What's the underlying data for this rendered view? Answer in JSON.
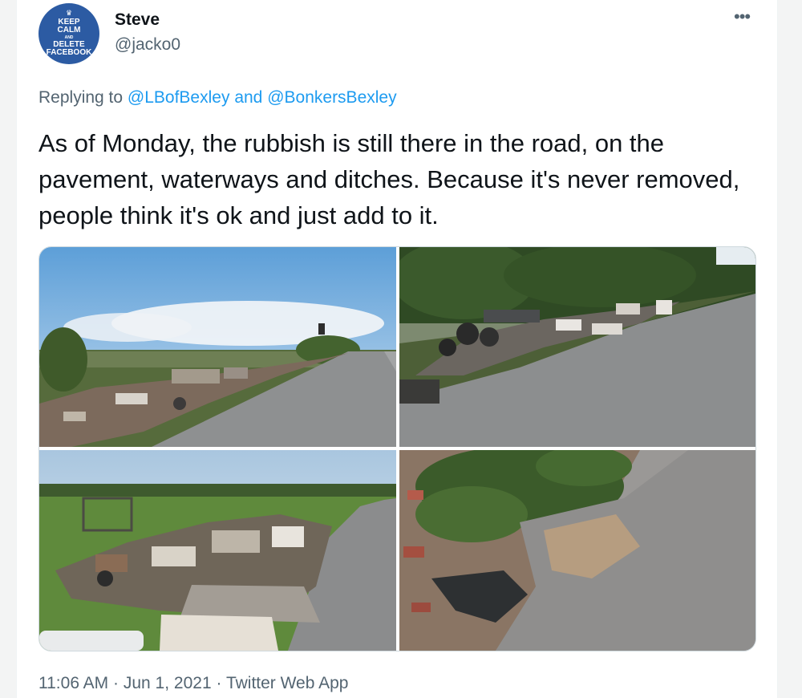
{
  "tweet": {
    "author": {
      "display_name": "Steve",
      "handle": "@jacko0",
      "avatar_text": [
        "KEEP",
        "CALM",
        "AND",
        "DELETE",
        "FACEBOOK"
      ]
    },
    "more_icon": "more-horizontal-icon",
    "replying_prefix": "Replying to",
    "replying_mention_1": "@LBofBexley",
    "replying_and": "and",
    "replying_mention_2": "@BonkersBexley",
    "text": "As of Monday, the rubbish is still there in the road, on the pavement, waterways and ditches. Because it's never removed, people think it's ok and just add to it.",
    "time": "11:06 AM",
    "separator": "·",
    "date": "Jun 1, 2021",
    "source": "Twitter Web App",
    "photos_count": 4
  },
  "colors": {
    "link": "#1d9bf0",
    "secondary_text": "#536471",
    "avatar_bg": "#2c5ba3"
  }
}
